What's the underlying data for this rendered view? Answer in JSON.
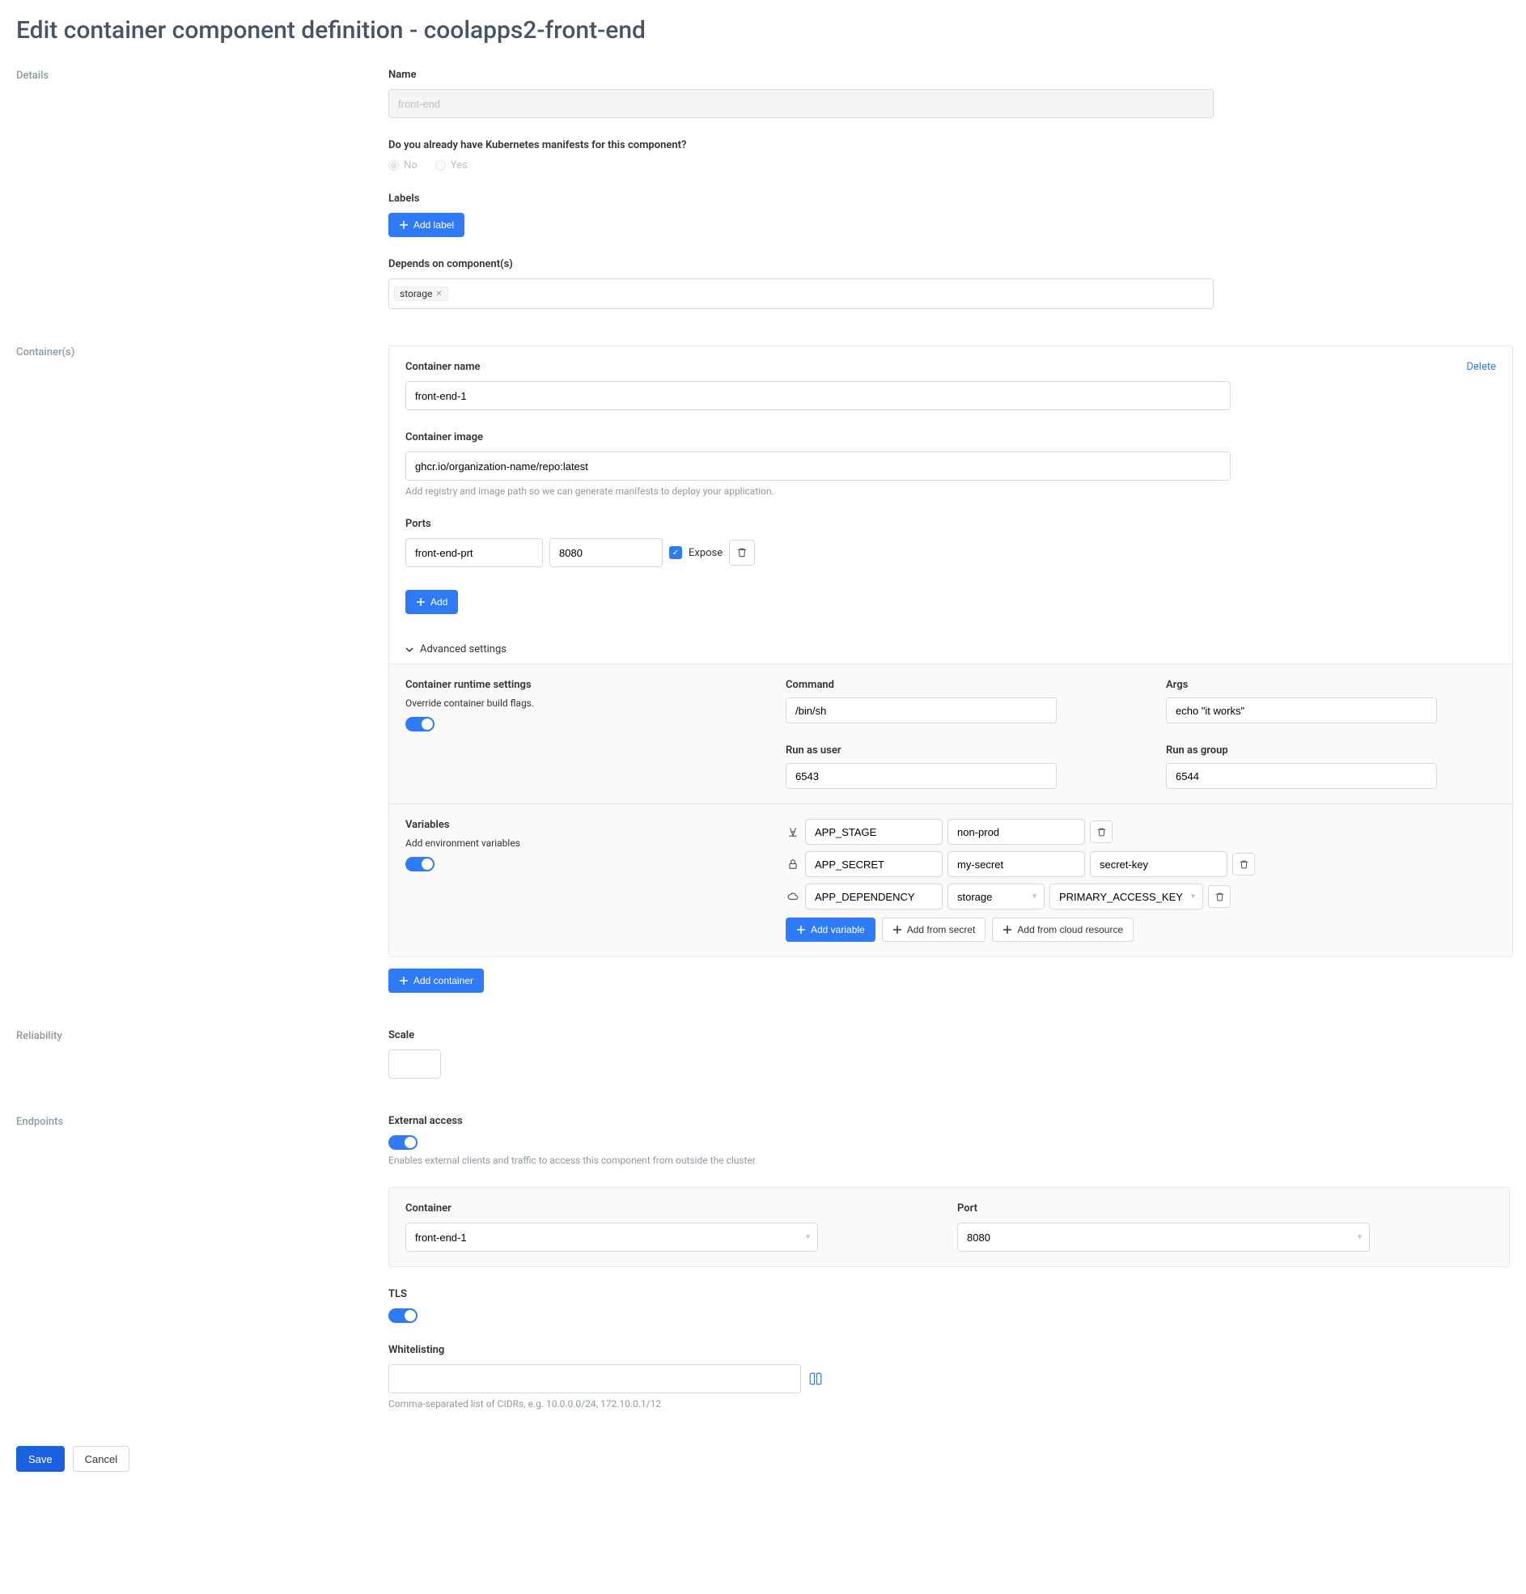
{
  "page": {
    "title": "Edit container component definition - coolapps2-front-end"
  },
  "sections": {
    "details": "Details",
    "containers": "Container(s)",
    "reliability": "Reliability",
    "endpoints": "Endpoints"
  },
  "details": {
    "name_label": "Name",
    "name_value": "front-end",
    "manifests_question": "Do you already have Kubernetes manifests for this component?",
    "opt_no": "No",
    "opt_yes": "Yes",
    "labels_label": "Labels",
    "add_label_btn": "Add label",
    "depends_label": "Depends on component(s)",
    "depends_tag": "storage"
  },
  "container": {
    "delete": "Delete",
    "name_label": "Container name",
    "name_value": "front-end-1",
    "image_label": "Container image",
    "image_value": "ghcr.io/organization-name/repo:latest",
    "image_help": "Add registry and image path so we can generate manifests to deploy your application.",
    "ports_label": "Ports",
    "port_name": "front-end-prt",
    "port_number": "8080",
    "expose": "Expose",
    "add_btn": "Add",
    "advanced": "Advanced settings",
    "runtime": {
      "title": "Container runtime settings",
      "help": "Override container build flags.",
      "command_label": "Command",
      "command_value": "/bin/sh",
      "args_label": "Args",
      "args_value": "echo \"it works\"",
      "user_label": "Run as user",
      "user_value": "6543",
      "group_label": "Run as group",
      "group_value": "6544"
    },
    "vars": {
      "title": "Variables",
      "help": "Add environment variables",
      "rows": [
        {
          "key": "APP_STAGE",
          "val": "non-prod"
        },
        {
          "key": "APP_SECRET",
          "val1": "my-secret",
          "val2": "secret-key"
        },
        {
          "key": "APP_DEPENDENCY",
          "val1": "storage",
          "val2": "PRIMARY_ACCESS_KEY"
        }
      ],
      "add_var": "Add variable",
      "add_secret": "Add from secret",
      "add_cloud": "Add from cloud resource"
    },
    "add_container": "Add container"
  },
  "reliability": {
    "scale_label": "Scale"
  },
  "endpoints": {
    "ext_label": "External access",
    "ext_help": "Enables external clients and traffic to access this component from outside the cluster",
    "container_label": "Container",
    "container_value": "front-end-1",
    "port_label": "Port",
    "port_value": "8080",
    "tls_label": "TLS",
    "whitelist_label": "Whitelisting",
    "whitelist_help": "Comma-separated list of CIDRs, e.g. 10.0.0.0/24, 172.10.0.1/12"
  },
  "footer": {
    "save": "Save",
    "cancel": "Cancel"
  }
}
